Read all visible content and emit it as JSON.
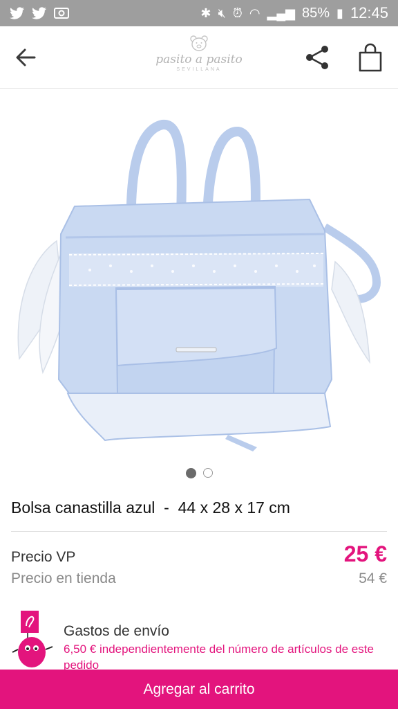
{
  "status_bar": {
    "left_icons": [
      "twitter-icon",
      "twitter-icon",
      "image-icon"
    ],
    "right_icons": [
      "bluetooth-icon",
      "mute-icon",
      "alarm-icon",
      "wifi-icon",
      "signal-icon"
    ],
    "battery": "85%",
    "time": "12:45"
  },
  "header": {
    "back_icon": "back-arrow-icon",
    "logo_text": "pasito a pasito",
    "logo_subtitle": "SEVILLANA",
    "share_icon": "share-icon",
    "cart_icon": "shopping-bag-icon"
  },
  "carousel": {
    "slide_count": 2,
    "active_index": 0
  },
  "product": {
    "title": "Bolsa canastilla azul  -  44 x 28 x 17 cm",
    "price_vp_label": "Precio VP",
    "price_vp": "25 €",
    "store_price_label": "Precio en tienda",
    "store_price": "54 €"
  },
  "shipping": {
    "title": "Gastos de envío",
    "description": "6,50 € independientemente del número de artículos de este pedido"
  },
  "cta": {
    "label": "Agregar al carrito"
  },
  "colors": {
    "accent": "#e3147d",
    "status_bar": "#9e9e9e",
    "bag": "#c9d9f2"
  }
}
